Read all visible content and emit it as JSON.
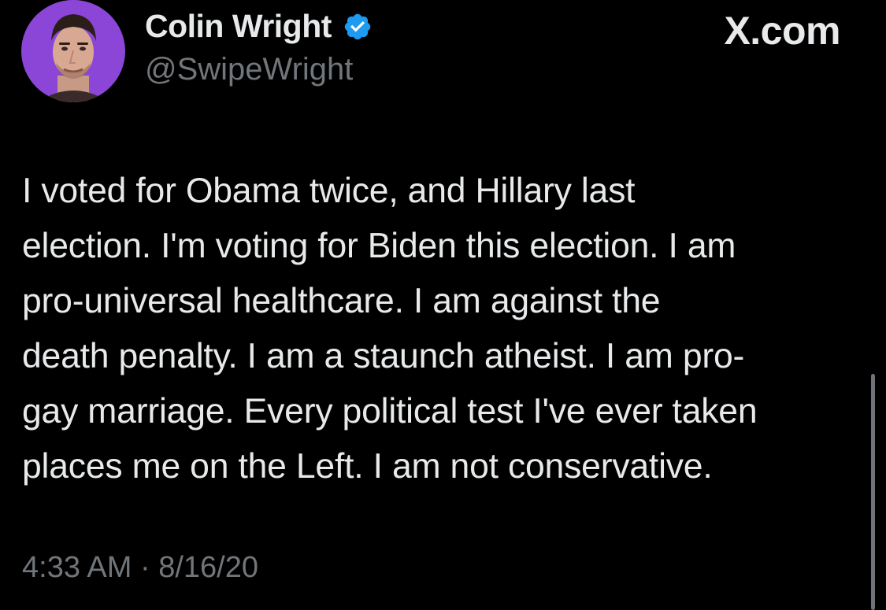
{
  "author": {
    "display_name": "Colin Wright",
    "handle": "@SwipeWright",
    "verified": true,
    "avatar_icon": "profile-photo"
  },
  "brand": "X.com",
  "tweet": {
    "text": "I voted for Obama twice, and Hillary last\nelection. I'm voting for Biden this election. I am\npro-universal healthcare. I am against the\ndeath penalty. I am a staunch atheist. I am pro-\ngay marriage. Every political test I've ever taken\nplaces me on the Left. I am not conservative.",
    "timestamp": "4:33 AM · 8/16/20"
  },
  "colors": {
    "background": "#000000",
    "text_primary": "#e7e9ea",
    "text_secondary": "#71767b",
    "verified_blue": "#1d9bf0",
    "avatar_ring": "#8b46d8"
  }
}
